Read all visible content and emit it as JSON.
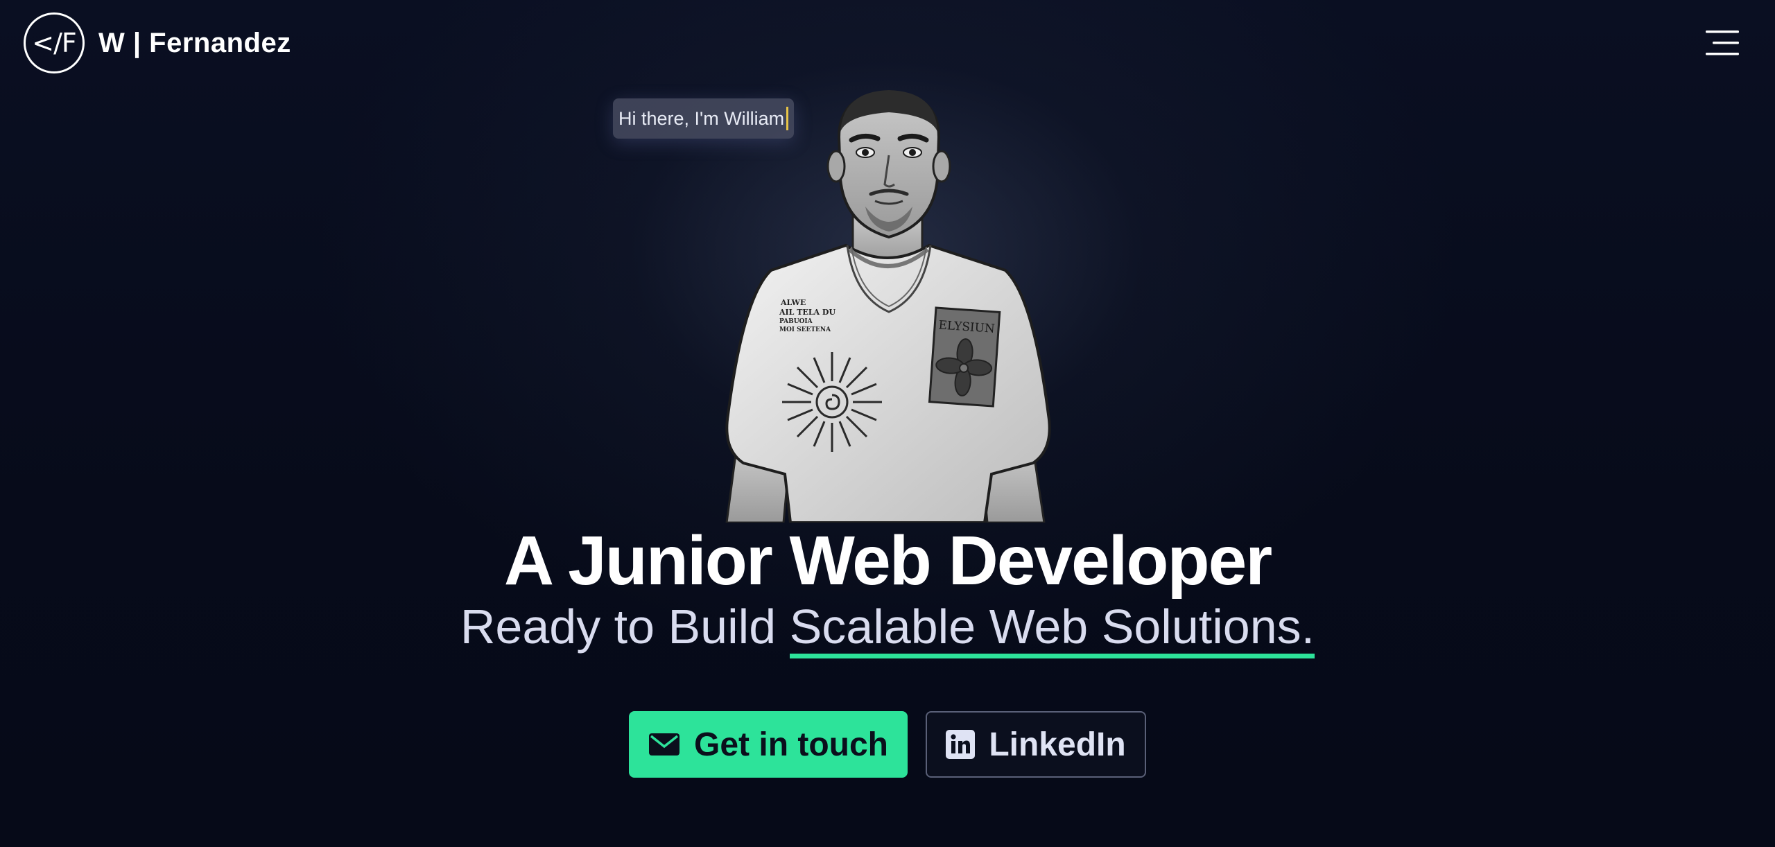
{
  "header": {
    "logo_text": "</F",
    "brand_name": "W | Fernandez",
    "menu_icon": "hamburger-menu-icon"
  },
  "hero": {
    "greeting": "Hi there, I'm William",
    "portrait_alt": "Illustrated portrait of William",
    "headline": "A Junior Web Developer",
    "subline_prefix": "Ready to Build ",
    "subline_highlight": "Scalable Web Solutions.",
    "shirt_text_left": [
      "ALWE",
      "AIL TELA DU",
      "PABUOIA",
      "MOI SEETENA"
    ],
    "shirt_patch_text": "ELYSIUN"
  },
  "cta": {
    "primary_label": "Get in touch",
    "primary_icon": "envelope-icon",
    "secondary_label": "LinkedIn",
    "secondary_icon": "linkedin-icon"
  },
  "colors": {
    "background": "#070b1a",
    "accent": "#2de39a",
    "text": "#ffffff",
    "subtext": "#d9dcef"
  }
}
